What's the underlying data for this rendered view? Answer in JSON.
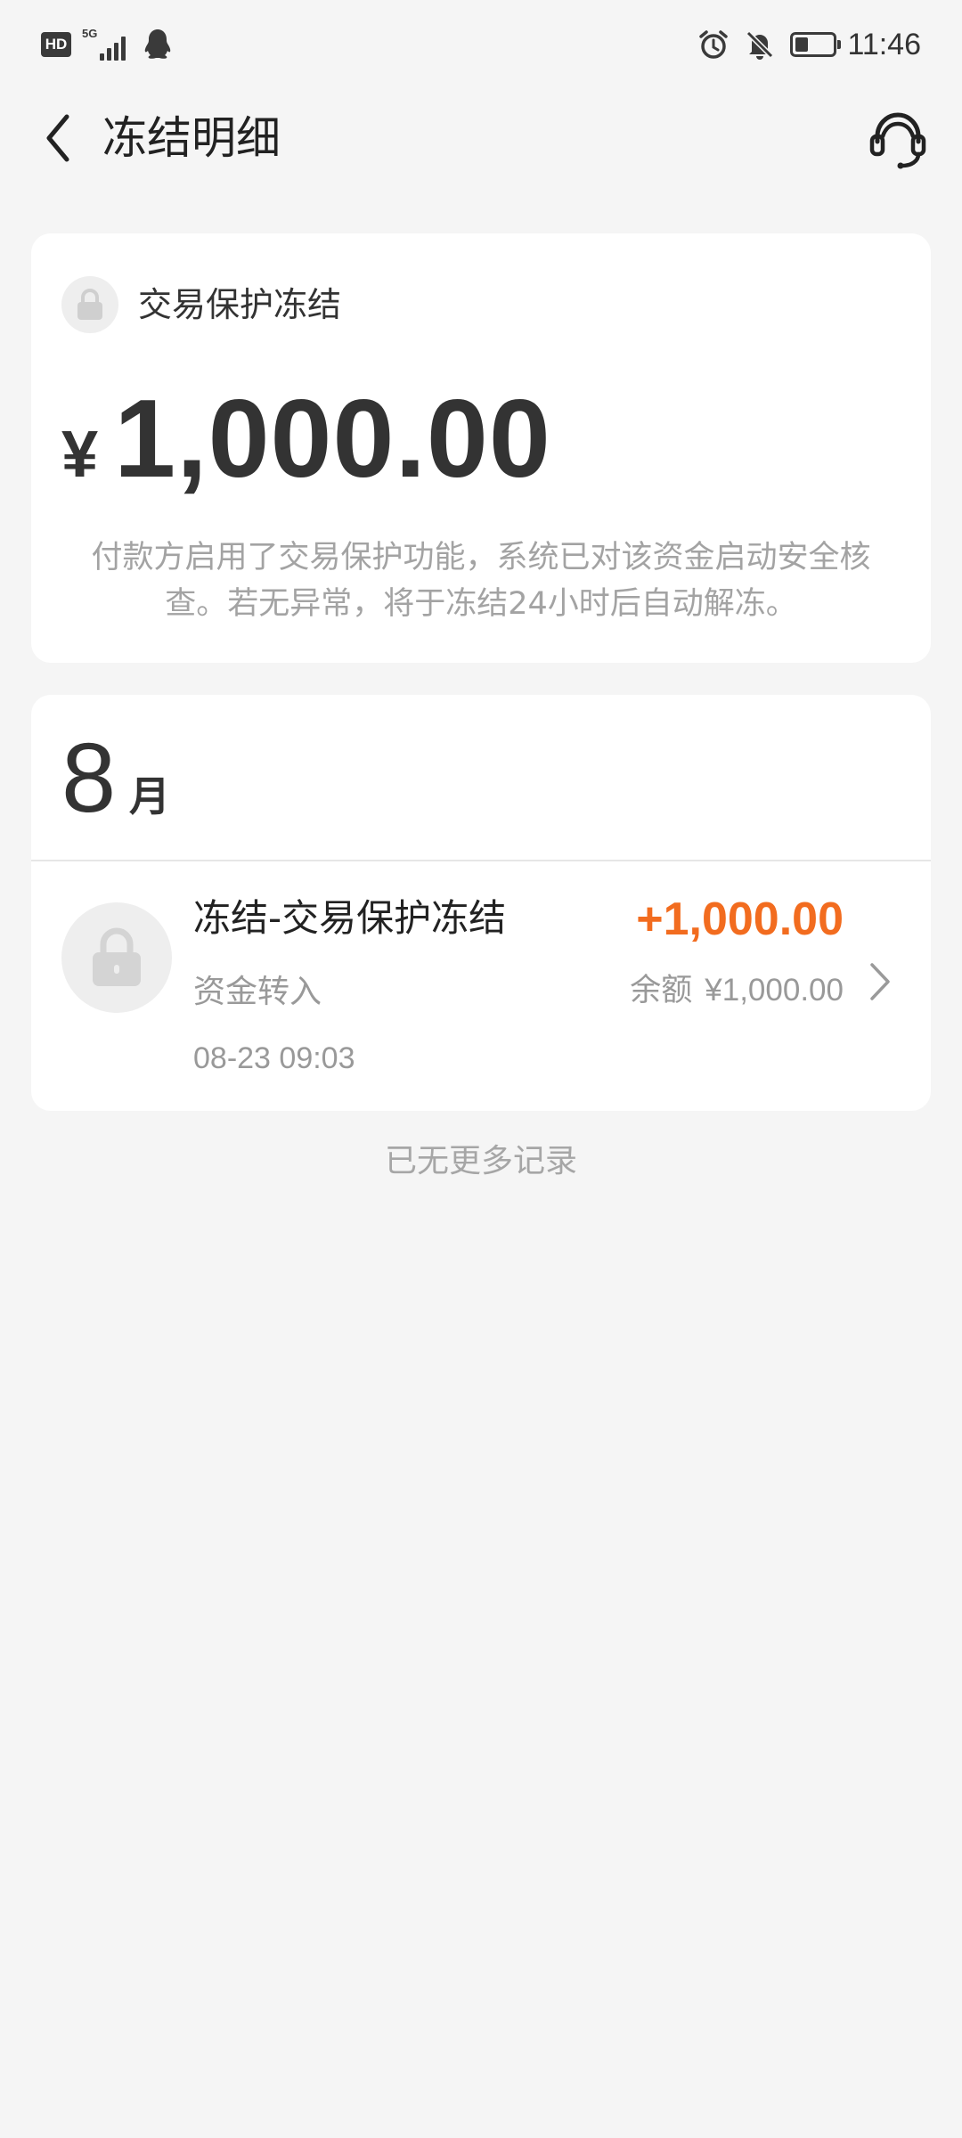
{
  "status_bar": {
    "network_badge": "HD",
    "network_type": "5G",
    "time": "11:46",
    "battery_level": 0.35,
    "icons": [
      "hd-icon",
      "signal-5g-icon",
      "qq-icon",
      "alarm-icon",
      "mute-bell-icon",
      "battery-icon"
    ]
  },
  "header": {
    "title": "冻结明细",
    "back_icon": "chevron-left-icon",
    "service_icon": "customer-service-headset-icon"
  },
  "summary": {
    "icon": "lock-icon",
    "type_label": "交易保护冻结",
    "currency": "¥",
    "amount": "1,000.00",
    "description": "付款方启用了交易保护功能，系统已对该资金启动安全核查。若无异常，将于冻结24小时后自动解冻。"
  },
  "records": {
    "month_number": "8",
    "month_unit": "月",
    "items": [
      {
        "icon": "lock-icon",
        "title": "冻结-交易保护冻结",
        "subtitle": "资金转入",
        "datetime": "08-23 09:03",
        "amount": "+1,000.00",
        "balance_label": "余额",
        "balance_value": "¥1,000.00"
      }
    ]
  },
  "footer": {
    "no_more": "已无更多记录"
  },
  "colors": {
    "background": "#f5f5f5",
    "card": "#ffffff",
    "accent_amount": "#f26c1f",
    "muted_text": "#999999"
  }
}
